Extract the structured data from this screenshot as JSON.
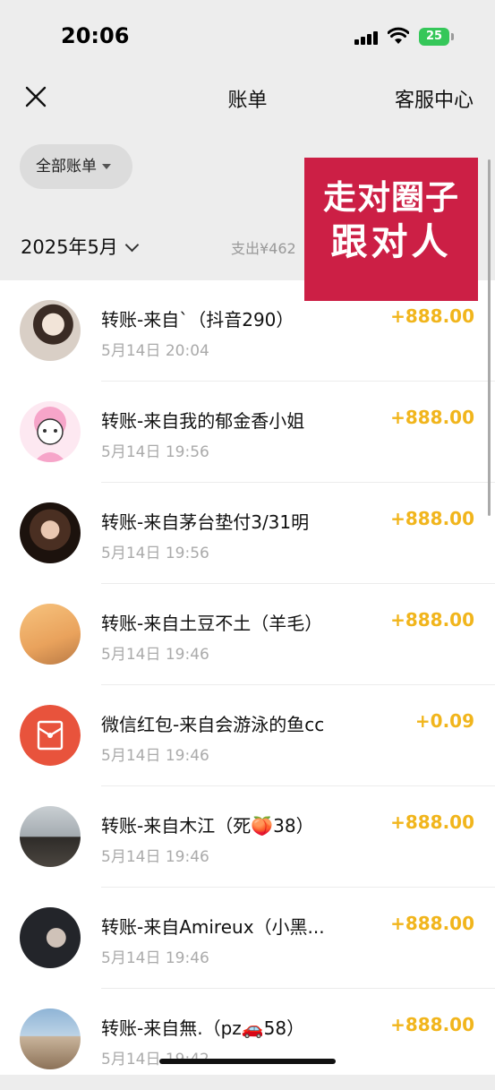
{
  "status": {
    "time": "20:06",
    "battery": "25"
  },
  "nav": {
    "title": "账单",
    "service": "客服中心"
  },
  "filter": {
    "label": "全部账单"
  },
  "summary": {
    "month": "2025年5月",
    "expense": "支出¥462"
  },
  "overlay": {
    "line1": "走对圈子",
    "line2": "跟对人"
  },
  "colors": {
    "amount": "#f1b51c",
    "overlay": "#cc1f45",
    "background": "#ededed"
  },
  "transactions": [
    {
      "title": "转账-来自`（抖音290）",
      "date": "5月14日 20:04",
      "amount": "+888.00",
      "avatar": "woman-photo"
    },
    {
      "title": "转账-来自我的郁金香小姐",
      "date": "5月14日 19:56",
      "amount": "+888.00",
      "avatar": "cartoon-girl"
    },
    {
      "title": "转账-来自茅台垫付3/31明",
      "date": "5月14日 19:56",
      "amount": "+888.00",
      "avatar": "dark-photo"
    },
    {
      "title": "转账-来自土豆不土（羊毛）",
      "date": "5月14日 19:46",
      "amount": "+888.00",
      "avatar": "sunset-wall"
    },
    {
      "title": "微信红包-来自会游泳的鱼cc",
      "date": "5月14日 19:46",
      "amount": "+0.09",
      "avatar": "red-packet-icon"
    },
    {
      "title": "转账-来自木江（死🍑38）",
      "date": "5月14日 19:46",
      "amount": "+888.00",
      "avatar": "person-sea"
    },
    {
      "title": "转账-来自Amireux（小黑...",
      "date": "5月14日 19:46",
      "amount": "+888.00",
      "avatar": "boy-photo"
    },
    {
      "title": "转账-来自無.（pz🚗58）",
      "date": "5月14日 19:42",
      "amount": "+888.00",
      "avatar": "couple-beach"
    }
  ]
}
